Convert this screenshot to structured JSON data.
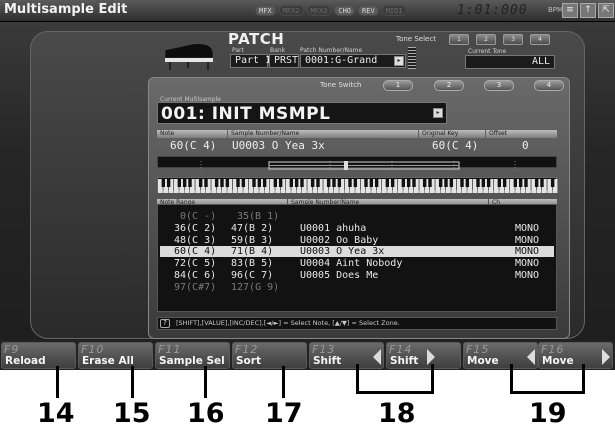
{
  "app": {
    "title": "Multisample Edit",
    "indicators": [
      {
        "label": "MFX",
        "active": true
      },
      {
        "label": "MFX2",
        "active": false
      },
      {
        "label": "MFX3",
        "active": false
      },
      {
        "label": "CHO",
        "active": true
      },
      {
        "label": "REV",
        "active": true
      },
      {
        "label": "MIDI",
        "active": false
      }
    ],
    "time": "1:01:000",
    "tempo": "BPM",
    "window_buttons": [
      "≡",
      "↑",
      "⇱"
    ]
  },
  "patch": {
    "heading": "PATCH",
    "part_caption": "Part",
    "part": "Part 1",
    "bank_caption": "Bank",
    "bank": "PRST",
    "number_caption": "Patch Number/Name",
    "number_name": "0001:G-Grand",
    "tone_select_label": "Tone Select",
    "tone_select": [
      "1",
      "2",
      "3",
      "4"
    ],
    "current_tone_caption": "Current Tone",
    "current_tone": "ALL"
  },
  "tone_switch": {
    "label": "Tone Switch",
    "buttons": [
      "1",
      "2",
      "3",
      "4"
    ]
  },
  "multisample": {
    "caption": "Current Multisample",
    "name": "001: INIT MSMPL"
  },
  "sample_header": {
    "note_caption": "Note",
    "sample_caption": "Sample Number/Name",
    "orig_key_caption": "Original Key",
    "offset_caption": "Offset",
    "note": "60(C 4)",
    "sample": "U0003 O Yea 3x",
    "orig_key": "60(C 4)",
    "offset": "0"
  },
  "list": {
    "headers": {
      "range": "Note Range",
      "sample": "Sample Number/Name",
      "ch": "Ch"
    },
    "rows": [
      {
        "low": "0(C -)",
        "high": "35(B 1)",
        "sample": "",
        "ch": "",
        "state": "dim"
      },
      {
        "low": "36(C 2)",
        "high": "47(B 2)",
        "sample": "U0001 ahuha",
        "ch": "MONO",
        "state": "normal"
      },
      {
        "low": "48(C 3)",
        "high": "59(B 3)",
        "sample": "U0002 Oo Baby",
        "ch": "MONO",
        "state": "normal"
      },
      {
        "low": "60(C 4)",
        "high": "71(B 4)",
        "sample": "U0003 O Yea 3x",
        "ch": "MONO",
        "state": "selected"
      },
      {
        "low": "72(C 5)",
        "high": "83(B 5)",
        "sample": "U0004 Aint Nobody",
        "ch": "MONO",
        "state": "normal"
      },
      {
        "low": "84(C 6)",
        "high": "96(C 7)",
        "sample": "U0005 Does Me",
        "ch": "MONO",
        "state": "normal"
      },
      {
        "low": "97(C#7)",
        "high": "127(G 9)",
        "sample": "",
        "ch": "",
        "state": "dim"
      }
    ]
  },
  "help": {
    "text": "[SHIFT],[VALUE],[INC/DEC],[◄/►] = Select Note, [▲/▼] = Select Zone."
  },
  "function_keys": [
    {
      "num": "F9",
      "label": "Reload"
    },
    {
      "num": "F10",
      "label": "Erase All"
    },
    {
      "num": "F11",
      "label": "Sample Sel"
    },
    {
      "num": "F12",
      "label": "Sort"
    },
    {
      "num": "F13",
      "label": "Shift"
    },
    {
      "num": "F14",
      "label": "Shift"
    },
    {
      "num": "F15",
      "label": "Move"
    },
    {
      "num": "F16",
      "label": "Move"
    }
  ],
  "callouts": [
    "14",
    "15",
    "16",
    "17",
    "18",
    "19"
  ]
}
